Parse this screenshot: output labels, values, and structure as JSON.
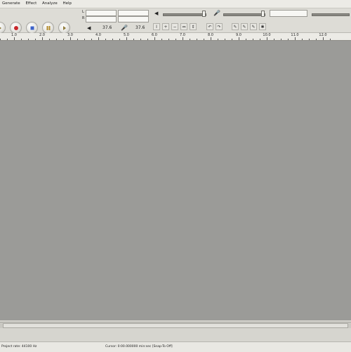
{
  "menu": [
    "Generate",
    "Effect",
    "Analyze",
    "Help"
  ],
  "meters": {
    "left_label": "L",
    "right_label": "R"
  },
  "mixer": {
    "output_value": "37.6",
    "input_value": "37.6"
  },
  "ruler": {
    "ticks": [
      "1.0",
      "2.0",
      "3.0",
      "4.0",
      "5.0",
      "6.0",
      "7.0",
      "8.0",
      "9.0",
      "10.0",
      "11.0",
      "12.0"
    ]
  },
  "status": {
    "rate": "Project rate: 44100 Hz",
    "cursor": "Cursor: 0:00.000000 min:sec [Snap-To Off]"
  }
}
